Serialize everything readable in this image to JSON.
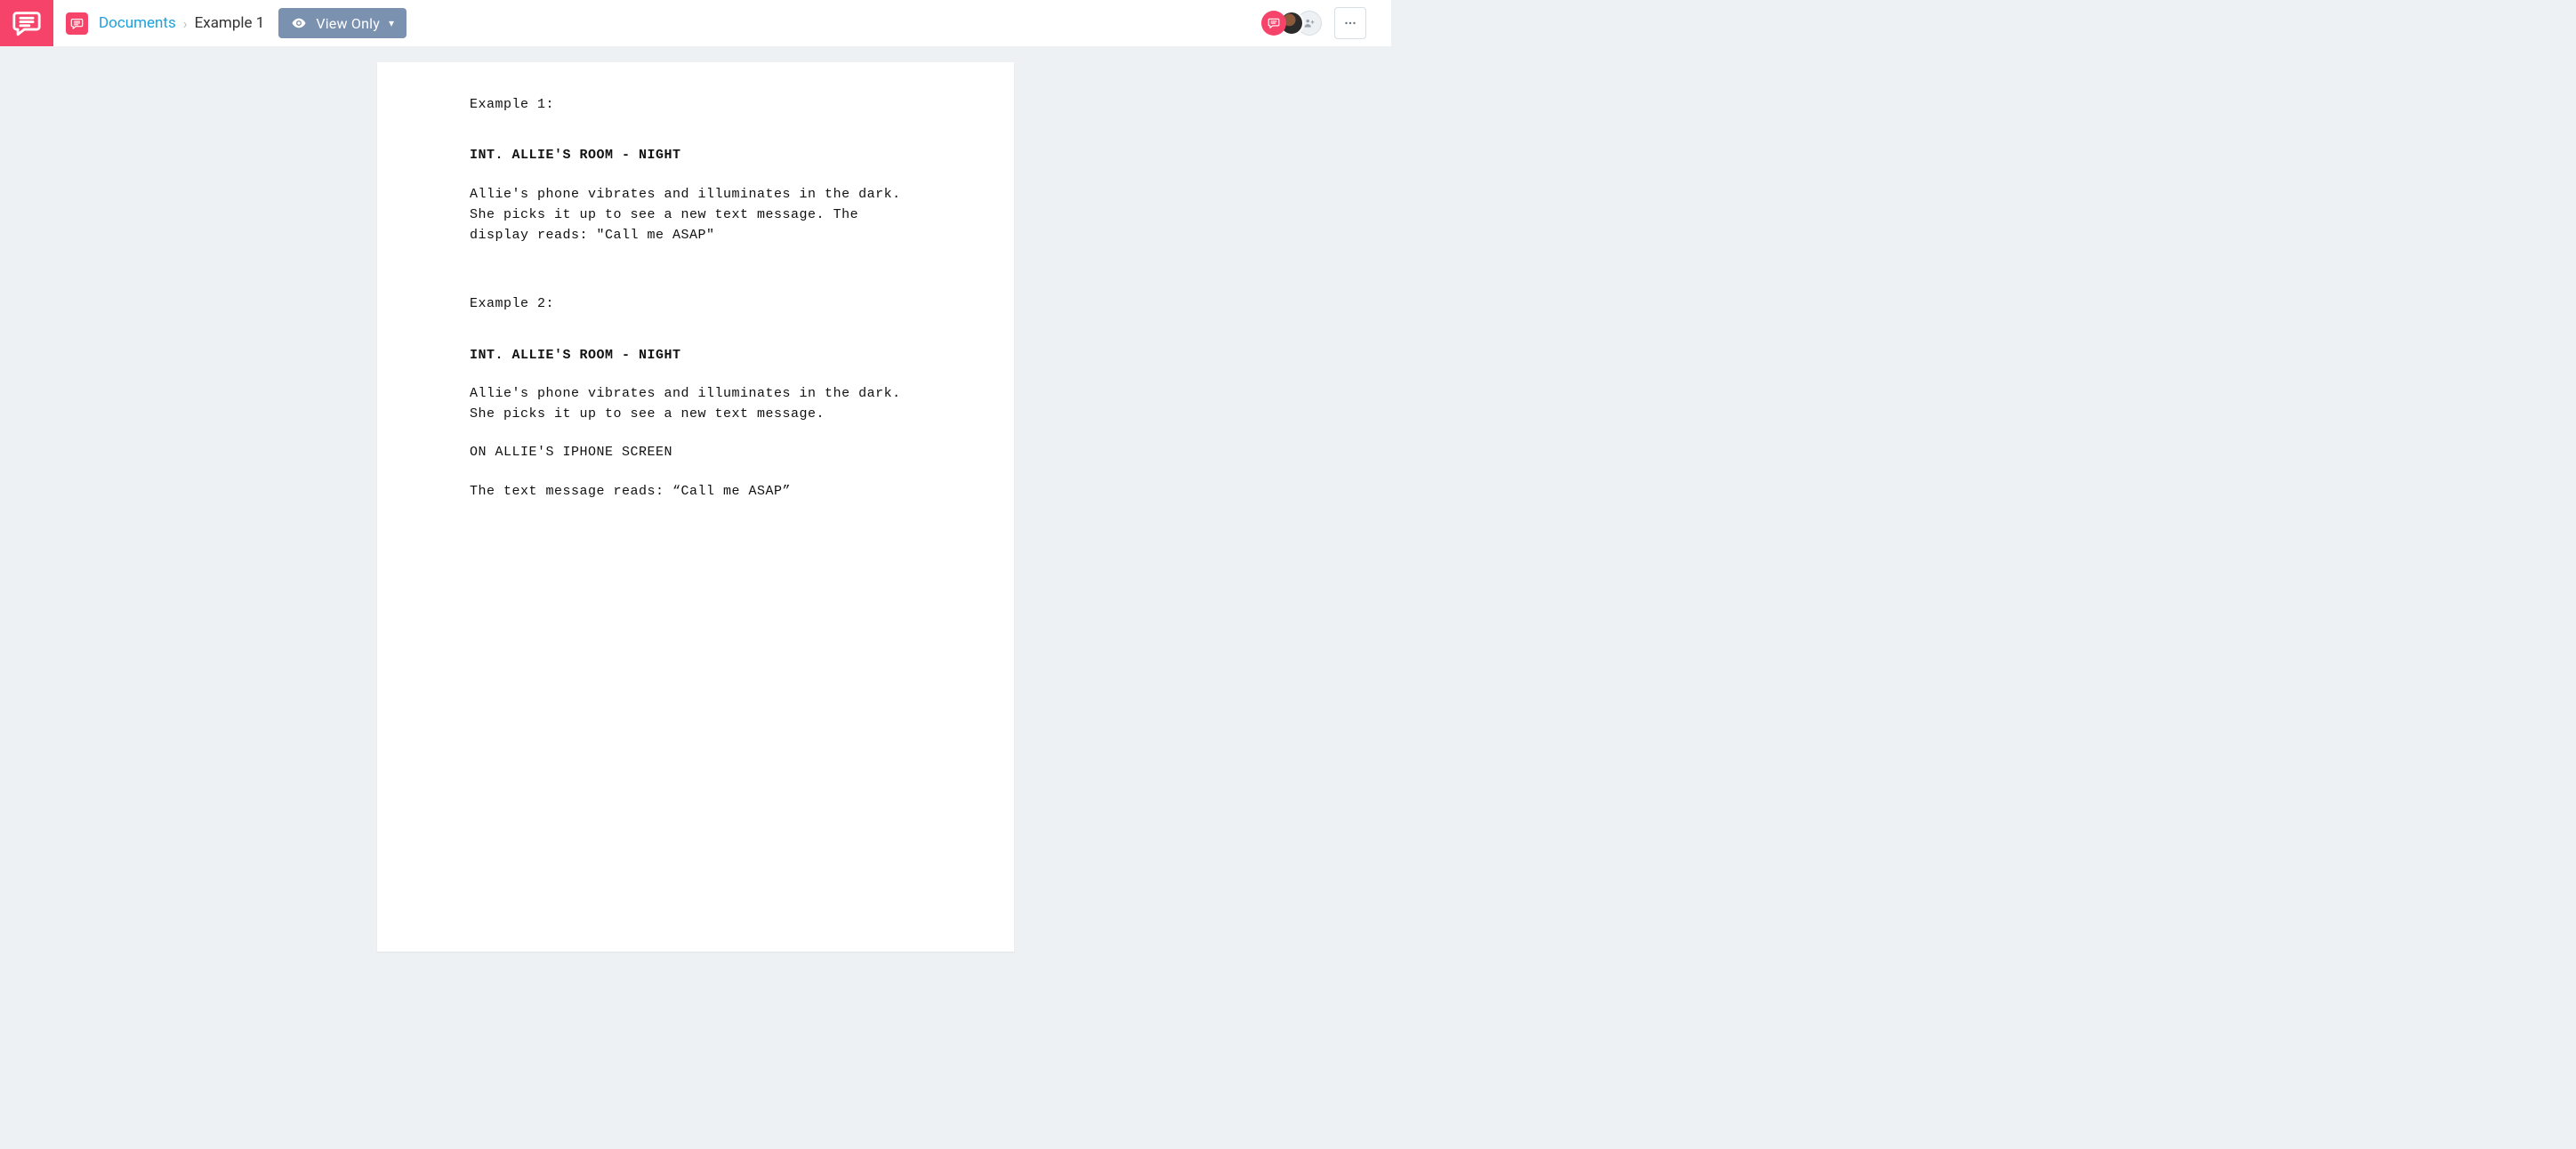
{
  "colors": {
    "brand": "#f6436a",
    "headerPill": "#7a91b0",
    "link": "#1ba2de"
  },
  "header": {
    "breadcrumb": {
      "documents_label": "Documents",
      "current_label": "Example 1"
    },
    "view_button": {
      "label": "View Only"
    }
  },
  "document": {
    "blocks": [
      {
        "kind": "p",
        "text": "Example 1:"
      },
      {
        "kind": "gap",
        "size": "md"
      },
      {
        "kind": "slug",
        "text": "INT. ALLIE'S ROOM - NIGHT"
      },
      {
        "kind": "gap",
        "size": "sm"
      },
      {
        "kind": "p",
        "text": "Allie's phone vibrates and illuminates in the dark. She picks it up to see a new text message. The display reads: \"Call me ASAP\""
      },
      {
        "kind": "gap",
        "size": "md"
      },
      {
        "kind": "gap",
        "size": "sm"
      },
      {
        "kind": "p",
        "text": "Example 2:"
      },
      {
        "kind": "gap",
        "size": "md"
      },
      {
        "kind": "slug",
        "text": "INT. ALLIE'S ROOM - NIGHT"
      },
      {
        "kind": "gap",
        "size": "sm"
      },
      {
        "kind": "p",
        "text": "Allie's phone vibrates and illuminates in the dark. She picks it up to see a new text message."
      },
      {
        "kind": "gap",
        "size": "sm"
      },
      {
        "kind": "p",
        "text": "ON ALLIE'S IPHONE SCREEN"
      },
      {
        "kind": "gap",
        "size": "sm"
      },
      {
        "kind": "p",
        "text": "The text message reads: “Call me ASAP”"
      }
    ]
  }
}
